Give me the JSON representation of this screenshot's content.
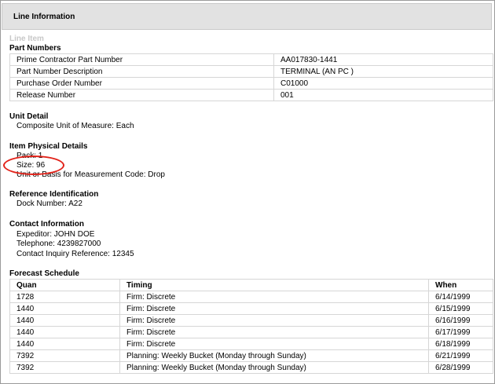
{
  "header": {
    "title": "Line Information"
  },
  "line_item_label": "Line Item",
  "part_numbers": {
    "title": "Part Numbers",
    "rows": [
      {
        "label": "Prime Contractor Part Number",
        "value": "AA017830-1441"
      },
      {
        "label": "Part Number Description",
        "value": "TERMINAL (AN PC )"
      },
      {
        "label": "Purchase Order Number",
        "value": "C01000"
      },
      {
        "label": "Release Number",
        "value": "001"
      }
    ]
  },
  "unit_detail": {
    "title": "Unit Detail",
    "composite": "Composite Unit of Measure: Each"
  },
  "physical": {
    "title": "Item Physical Details",
    "pack": "Pack: 1",
    "size": "Size: 96",
    "basis": "Unit or Basis for Measurement Code: Drop"
  },
  "reference": {
    "title": "Reference Identification",
    "dock": "Dock Number: A22"
  },
  "contact": {
    "title": "Contact Information",
    "expeditor": "Expeditor: JOHN DOE",
    "telephone": "Telephone: 4239827000",
    "inquiry": "Contact Inquiry Reference: 12345"
  },
  "forecast": {
    "title": "Forecast Schedule",
    "headers": {
      "quan": "Quan",
      "timing": "Timing",
      "when": "When"
    },
    "rows": [
      {
        "quan": "1728",
        "timing": "Firm: Discrete",
        "when": "6/14/1999"
      },
      {
        "quan": "1440",
        "timing": "Firm: Discrete",
        "when": "6/15/1999"
      },
      {
        "quan": "1440",
        "timing": "Firm: Discrete",
        "when": "6/16/1999"
      },
      {
        "quan": "1440",
        "timing": "Firm: Discrete",
        "when": "6/17/1999"
      },
      {
        "quan": "1440",
        "timing": "Firm: Discrete",
        "when": "6/18/1999"
      },
      {
        "quan": "7392",
        "timing": "Planning: Weekly Bucket (Monday through Sunday)",
        "when": "6/21/1999"
      },
      {
        "quan": "7392",
        "timing": "Planning: Weekly Bucket (Monday through Sunday)",
        "when": "6/28/1999"
      }
    ]
  },
  "annotation_color": "#e2231a"
}
